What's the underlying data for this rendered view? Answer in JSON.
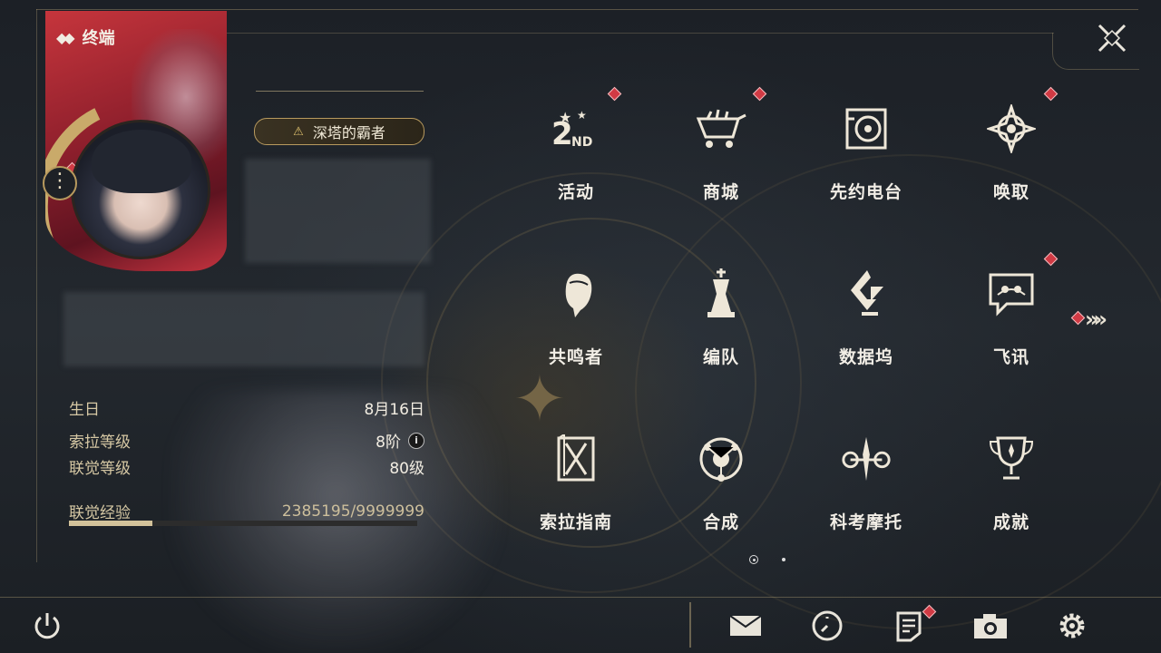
{
  "header": {
    "title": "终端"
  },
  "profile": {
    "title_badge": "深塔的霸者",
    "birthday_label": "生日",
    "birthday_value": "8月16日",
    "sola_level_label": "索拉等级",
    "sola_level_value": "8阶",
    "union_level_label": "联觉等级",
    "union_level_value": "80级",
    "union_exp_label": "联觉经验",
    "union_exp_value": "2385195/9999999",
    "union_exp_fraction": 0.2385
  },
  "menu": [
    {
      "label": "活动",
      "icon": "event-2nd-anniversary-icon",
      "badge": true
    },
    {
      "label": "商城",
      "icon": "shop-cart-icon",
      "badge": true
    },
    {
      "label": "先约电台",
      "icon": "radio-pass-icon",
      "badge": false
    },
    {
      "label": "唤取",
      "icon": "convene-icon",
      "badge": true
    },
    {
      "label": "共鸣者",
      "icon": "resonator-icon",
      "badge": false
    },
    {
      "label": "编队",
      "icon": "team-chess-icon",
      "badge": false
    },
    {
      "label": "数据坞",
      "icon": "data-bank-icon",
      "badge": false
    },
    {
      "label": "飞讯",
      "icon": "chat-icon",
      "badge": true
    },
    {
      "label": "索拉指南",
      "icon": "guidebook-icon",
      "badge": false
    },
    {
      "label": "合成",
      "icon": "synthesis-icon",
      "badge": false
    },
    {
      "label": "科考摩托",
      "icon": "motorbike-icon",
      "badge": false
    },
    {
      "label": "成就",
      "icon": "achievement-trophy-icon",
      "badge": false
    }
  ],
  "colors": {
    "accent_gold": "#c9aa6a",
    "badge_red": "#d13a44",
    "card_red": "#c6353c"
  }
}
